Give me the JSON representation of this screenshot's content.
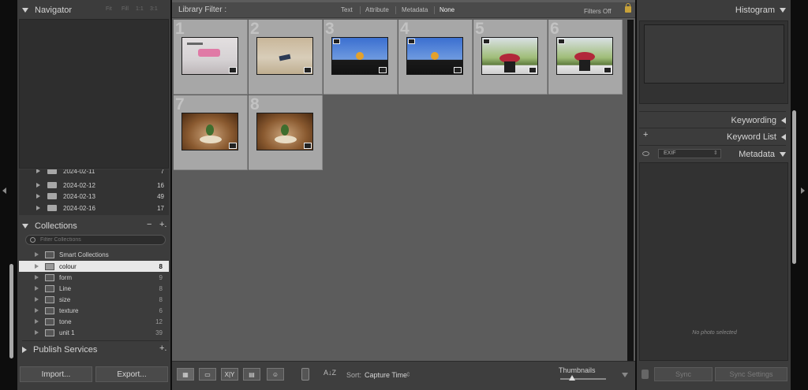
{
  "navigator": {
    "title": "Navigator",
    "zoom": [
      "Fit",
      "Fill",
      "1:1",
      "3:1"
    ]
  },
  "folders": [
    {
      "label": "2024-02-11",
      "count": "7"
    },
    {
      "label": "2024-02-12",
      "count": "16"
    },
    {
      "label": "2024-02-13",
      "count": "49"
    },
    {
      "label": "2024-02-16",
      "count": "17"
    }
  ],
  "collections": {
    "title": "Collections",
    "minus": "−",
    "plus": "+.",
    "search_placeholder": "Filter Collections",
    "items": [
      {
        "label": "Smart Collections",
        "count": ""
      },
      {
        "label": "colour",
        "count": "8"
      },
      {
        "label": "form",
        "count": "9"
      },
      {
        "label": "Line",
        "count": "8"
      },
      {
        "label": "size",
        "count": "8"
      },
      {
        "label": "texture",
        "count": "6"
      },
      {
        "label": "tone",
        "count": "12"
      },
      {
        "label": "unit 1",
        "count": "39"
      }
    ]
  },
  "publish": {
    "title": "Publish Services",
    "plus": "+."
  },
  "buttons": {
    "import": "Import...",
    "export": "Export..."
  },
  "filterbar": {
    "label": "Library Filter :",
    "options": [
      "Text",
      "Attribute",
      "Metadata",
      "None"
    ],
    "status": "Filters Off"
  },
  "grid": {
    "cells": [
      {
        "num": "1"
      },
      {
        "num": "2"
      },
      {
        "num": "3"
      },
      {
        "num": "4"
      },
      {
        "num": "5"
      },
      {
        "num": "6"
      },
      {
        "num": "7"
      },
      {
        "num": "8"
      }
    ]
  },
  "toolbar": {
    "sort_label": "Sort:",
    "sort_value": "Capture Time",
    "thumb_label": "Thumbnails",
    "compare_label": "X|Y",
    "az_label": "A↓Z"
  },
  "right": {
    "histogram": "Histogram",
    "keywording": "Keywording",
    "keyword_list": "Keyword List",
    "keyword_plus": "+",
    "metadata": "Metadata",
    "exif": "EXIF",
    "no_photo": "No photo selected",
    "sync": "Sync",
    "sync_settings": "Sync Settings"
  }
}
